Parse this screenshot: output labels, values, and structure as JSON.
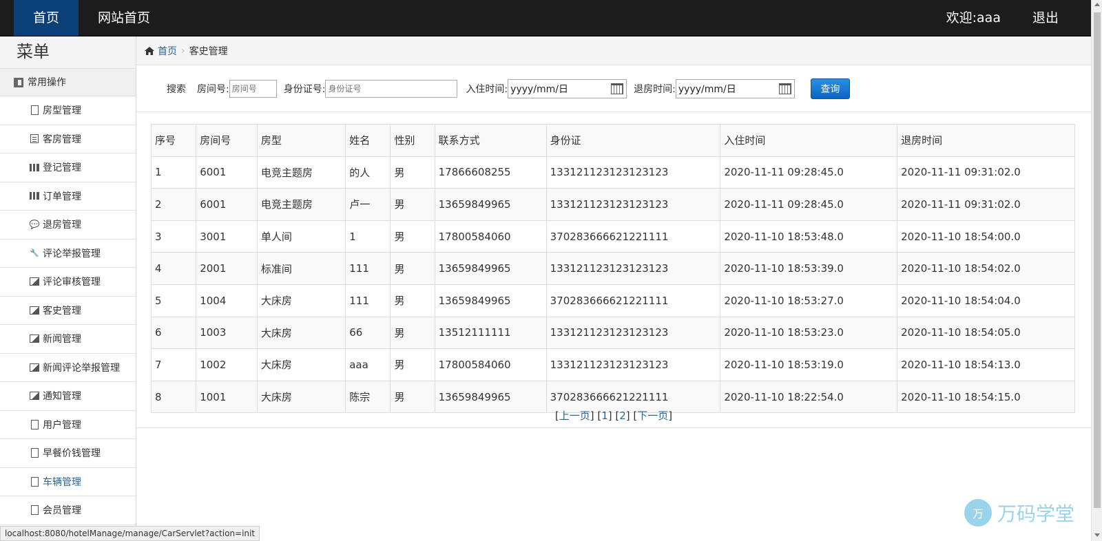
{
  "navbar": {
    "home": "首页",
    "site_home": "网站首页",
    "welcome": "欢迎:aaa",
    "logout": "退出"
  },
  "sidebar": {
    "title": "菜单",
    "group": "常用操作",
    "items": [
      {
        "label": "房型管理",
        "icon": "file-icon"
      },
      {
        "label": "客房管理",
        "icon": "list-icon"
      },
      {
        "label": "登记管理",
        "icon": "books-icon"
      },
      {
        "label": "订单管理",
        "icon": "books-icon"
      },
      {
        "label": "退房管理",
        "icon": "comment-icon"
      },
      {
        "label": "评论举报管理",
        "icon": "wrench-icon"
      },
      {
        "label": "评论审核管理",
        "icon": "picture-icon"
      },
      {
        "label": "客史管理",
        "icon": "picture-icon"
      },
      {
        "label": "新闻管理",
        "icon": "picture-icon"
      },
      {
        "label": "新闻评论举报管理",
        "icon": "picture-icon"
      },
      {
        "label": "通知管理",
        "icon": "picture-icon"
      },
      {
        "label": "用户管理",
        "icon": "file-icon"
      },
      {
        "label": "早餐价钱管理",
        "icon": "file-icon"
      },
      {
        "label": "车辆管理",
        "icon": "file-icon"
      },
      {
        "label": "会员管理",
        "icon": "file-icon"
      }
    ]
  },
  "breadcrumb": {
    "home": "首页",
    "current": "客史管理"
  },
  "search": {
    "title": "搜索",
    "room_label": "房间号:",
    "room_placeholder": "房间号",
    "id_label": "身份证号:",
    "id_placeholder": "身份证号",
    "checkin_label": "入住时间:",
    "checkin_value": "yyyy/mm/日",
    "checkout_label": "退房时间:",
    "checkout_value": "yyyy/mm/日",
    "query_button": "查询"
  },
  "table": {
    "headers": [
      "序号",
      "房间号",
      "房型",
      "姓名",
      "性别",
      "联系方式",
      "身份证",
      "入住时间",
      "退房时间"
    ],
    "rows": [
      [
        "1",
        "6001",
        "电竞主题房",
        "的人",
        "男",
        "17866608255",
        "133121123123123123",
        "2020-11-11 09:28:45.0",
        "2020-11-11 09:31:02.0"
      ],
      [
        "2",
        "6001",
        "电竞主题房",
        "卢一",
        "男",
        "13659849965",
        "133121123123123123",
        "2020-11-11 09:28:45.0",
        "2020-11-11 09:31:02.0"
      ],
      [
        "3",
        "3001",
        "单人间",
        "1",
        "男",
        "17800584060",
        "370283666621221111",
        "2020-11-10 18:53:48.0",
        "2020-11-10 18:54:00.0"
      ],
      [
        "4",
        "2001",
        "标准间",
        "111",
        "男",
        "13659849965",
        "133121123123123123",
        "2020-11-10 18:53:39.0",
        "2020-11-10 18:54:02.0"
      ],
      [
        "5",
        "1004",
        "大床房",
        "111",
        "男",
        "13659849965",
        "370283666621221111",
        "2020-11-10 18:53:27.0",
        "2020-11-10 18:54:04.0"
      ],
      [
        "6",
        "1003",
        "大床房",
        "66",
        "男",
        "13512111111",
        "133121123123123123",
        "2020-11-10 18:53:23.0",
        "2020-11-10 18:54:05.0"
      ],
      [
        "7",
        "1002",
        "大床房",
        "aaa",
        "男",
        "17800584060",
        "133121123123123123",
        "2020-11-10 18:53:19.0",
        "2020-11-10 18:54:13.0"
      ],
      [
        "8",
        "1001",
        "大床房",
        "陈宗",
        "男",
        "13659849965",
        "370283666621221111",
        "2020-11-10 18:22:54.0",
        "2020-11-10 18:54:15.0"
      ]
    ]
  },
  "pager": {
    "prev": "上一页",
    "page1": "1",
    "page2": "2",
    "next": "下一页"
  },
  "statusbar": "localhost:8080/hotelManage/manage/CarServlet?action=init",
  "watermark": {
    "logo": "万",
    "text": "万码学堂"
  },
  "colors": {
    "navbar_bg": "#1c1c1c",
    "nav_active_bg": "#0a3f78",
    "link": "#2a6496",
    "button": "#0a63c2"
  }
}
